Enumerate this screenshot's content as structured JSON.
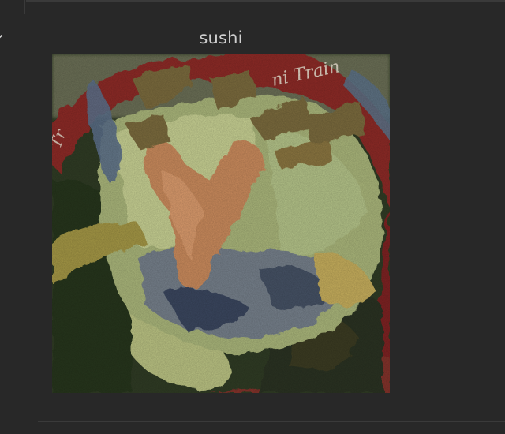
{
  "cell": {
    "caption": "sushi",
    "image": {
      "subject": "generated painterly image of a plate of food",
      "border_text": "ni Train"
    },
    "icons": {
      "collapse": "chevron-icon"
    }
  },
  "colors": {
    "background": "#282828",
    "caption_text": "#cfcfcf",
    "divider": "#3a3a3a",
    "plate_rim": "#8c2a26"
  }
}
